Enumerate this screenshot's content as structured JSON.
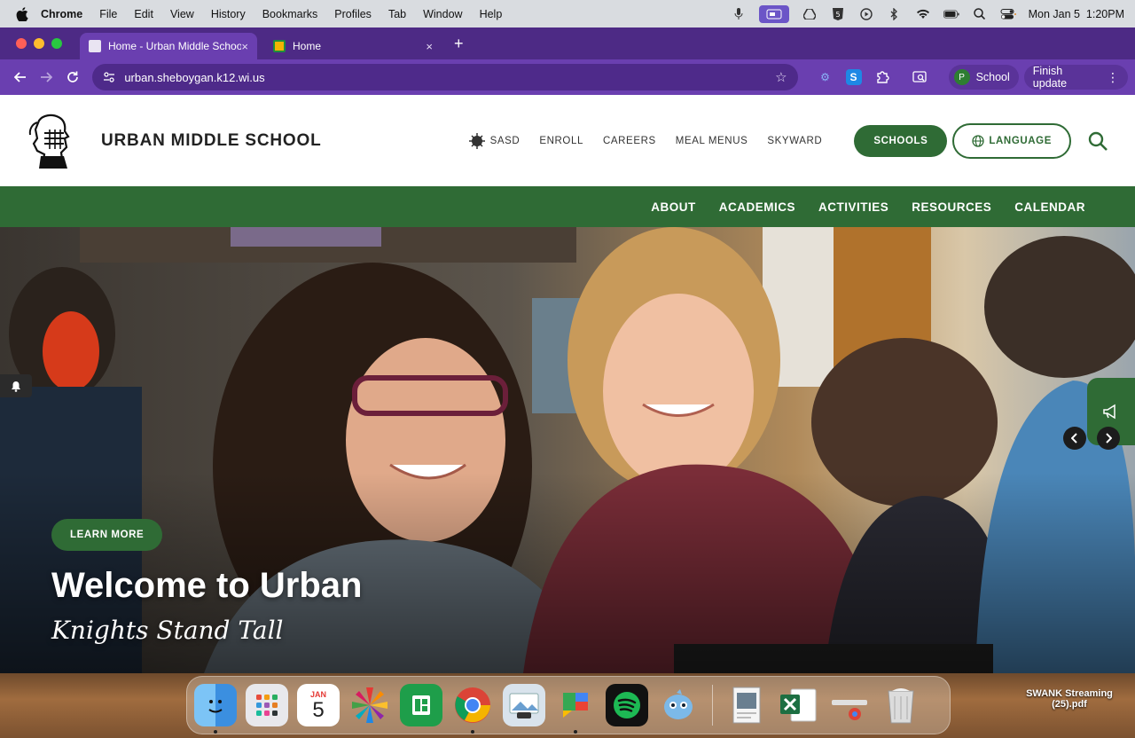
{
  "menubar": {
    "app": "Chrome",
    "items": [
      "File",
      "Edit",
      "View",
      "History",
      "Bookmarks",
      "Profiles",
      "Tab",
      "Window",
      "Help"
    ],
    "clock": "Mon Jan 5  1:20PM"
  },
  "browser": {
    "tabs": [
      {
        "title": "Home - Urban Middle School",
        "close": "×"
      },
      {
        "title": "Home",
        "close": "×"
      }
    ],
    "new_tab": "+",
    "url": "urban.sheboygan.k12.wi.us",
    "profile": {
      "initial": "P",
      "label": "School"
    },
    "update_label": "Finish update"
  },
  "site": {
    "name": "URBAN MIDDLE SCHOOL",
    "top_links": [
      "SASD",
      "ENROLL",
      "CAREERS",
      "MEAL MENUS",
      "SKYWARD"
    ],
    "schools_button": "SCHOOLS",
    "language_button": "LANGUAGE",
    "main_nav": [
      "ABOUT",
      "ACADEMICS",
      "ACTIVITIES",
      "RESOURCES",
      "CALENDAR"
    ],
    "hero": {
      "cta": "LEARN MORE",
      "title": "Welcome to Urban",
      "subtitle": "Knights Stand Tall"
    },
    "colors": {
      "brand_green": "#2f6b35",
      "chrome_purple": "#6a3fb0"
    }
  },
  "dock": {
    "calendar_month": "JAN",
    "calendar_day": "5",
    "icons": [
      "finder-icon",
      "launchpad-icon",
      "calendar-icon",
      "pinwheel-icon",
      "sheets-icon",
      "chrome-icon",
      "preview-icon",
      "google-chat-icon",
      "spotify-icon",
      "tweetbot-icon",
      "pdf-file-icon",
      "excel-icon",
      "chrome-app-icon",
      "trash-icon"
    ]
  },
  "desktop_file": {
    "name": "SWANK Streaming (25).pdf"
  }
}
